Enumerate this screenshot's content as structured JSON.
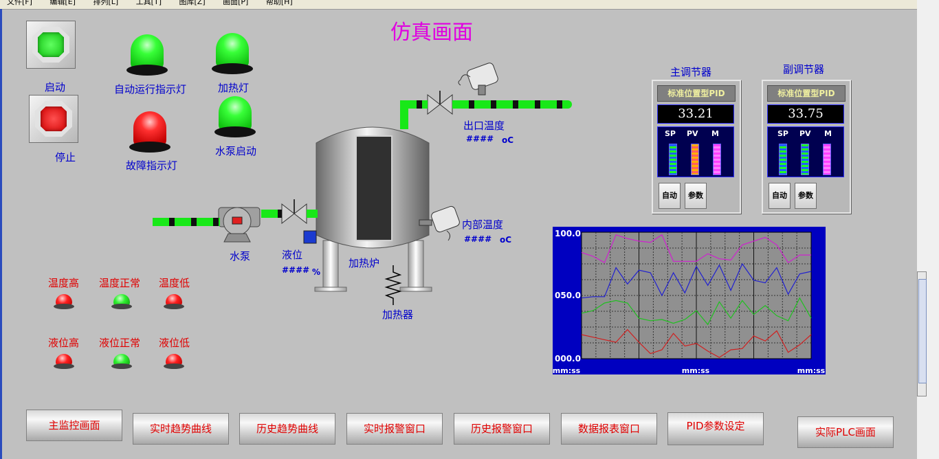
{
  "menu": [
    "文件[F]",
    "编辑[E]",
    "排列[L]",
    "工具[T]",
    "图库[Z]",
    "画面[P]",
    "帮助[H]"
  ],
  "title": "仿真画面",
  "controls": {
    "start_label": "启动",
    "stop_label": "停止"
  },
  "lamps": {
    "auto_run": "自动运行指示灯",
    "heat": "加热灯",
    "fault": "故障指示灯",
    "pump_start": "水泵启动"
  },
  "process": {
    "outlet_temp_label": "出口温度",
    "outlet_temp_value": "####",
    "outlet_temp_unit": "oC",
    "inner_temp_label": "内部温度",
    "inner_temp_value": "####",
    "inner_temp_unit": "oC",
    "pump_label": "水泵",
    "level_label": "液位",
    "level_value": "####",
    "level_unit": "%",
    "furnace_label": "加热炉",
    "heater_label": "加热器"
  },
  "alarms": {
    "temp_high": "温度高",
    "temp_normal": "温度正常",
    "temp_low": "温度低",
    "level_high": "液位高",
    "level_normal": "液位正常",
    "level_low": "液位低"
  },
  "regulators": [
    {
      "title": "主调节器",
      "type": "标准位置型PID",
      "value": "33.21",
      "sp": "SP",
      "pv": "PV",
      "m": "M",
      "auto": "自动",
      "param": "参数"
    },
    {
      "title": "副调节器",
      "type": "标准位置型PID",
      "value": "33.75",
      "sp": "SP",
      "pv": "PV",
      "m": "M",
      "auto": "自动",
      "param": "参数"
    }
  ],
  "chart_data": {
    "type": "line",
    "y_ticks": [
      "100.0",
      "050.0",
      "000.0"
    ],
    "x_ticks": [
      "mm:ss",
      "mm:ss",
      "mm:ss"
    ],
    "ylim": [
      0,
      100
    ],
    "grid": true,
    "colors": {
      "bg": "#0000c0",
      "plot": "#909090"
    },
    "series": [
      {
        "color": "#d020d0",
        "values": [
          84,
          81,
          76,
          98,
          95,
          93,
          92,
          98,
          77,
          77,
          77,
          83,
          79,
          78,
          90,
          93,
          96,
          90,
          76,
          82,
          82
        ]
      },
      {
        "color": "#2020d0",
        "values": [
          48,
          49,
          49,
          72,
          59,
          70,
          68,
          50,
          68,
          52,
          73,
          58,
          74,
          54,
          75,
          62,
          60,
          72,
          51,
          67,
          69
        ]
      },
      {
        "color": "#20c020",
        "values": [
          36,
          38,
          44,
          46,
          44,
          32,
          30,
          31,
          28,
          31,
          38,
          27,
          45,
          32,
          46,
          35,
          42,
          34,
          30,
          48,
          32
        ]
      },
      {
        "color": "#d02020",
        "values": [
          19,
          17,
          15,
          13,
          23,
          13,
          4,
          7,
          20,
          10,
          12,
          6,
          1,
          7,
          8,
          18,
          14,
          22,
          5,
          11,
          19
        ]
      }
    ]
  },
  "nav": {
    "main_monitor": "主监控画面",
    "realtime_trend": "实时趋势曲线",
    "history_trend": "历史趋势曲线",
    "realtime_alarm": "实时报警窗口",
    "history_alarm": "历史报警窗口",
    "data_report": "数据报表窗口",
    "pid_setting": "PID参数设定",
    "actual_plc": "实际PLC画面"
  }
}
